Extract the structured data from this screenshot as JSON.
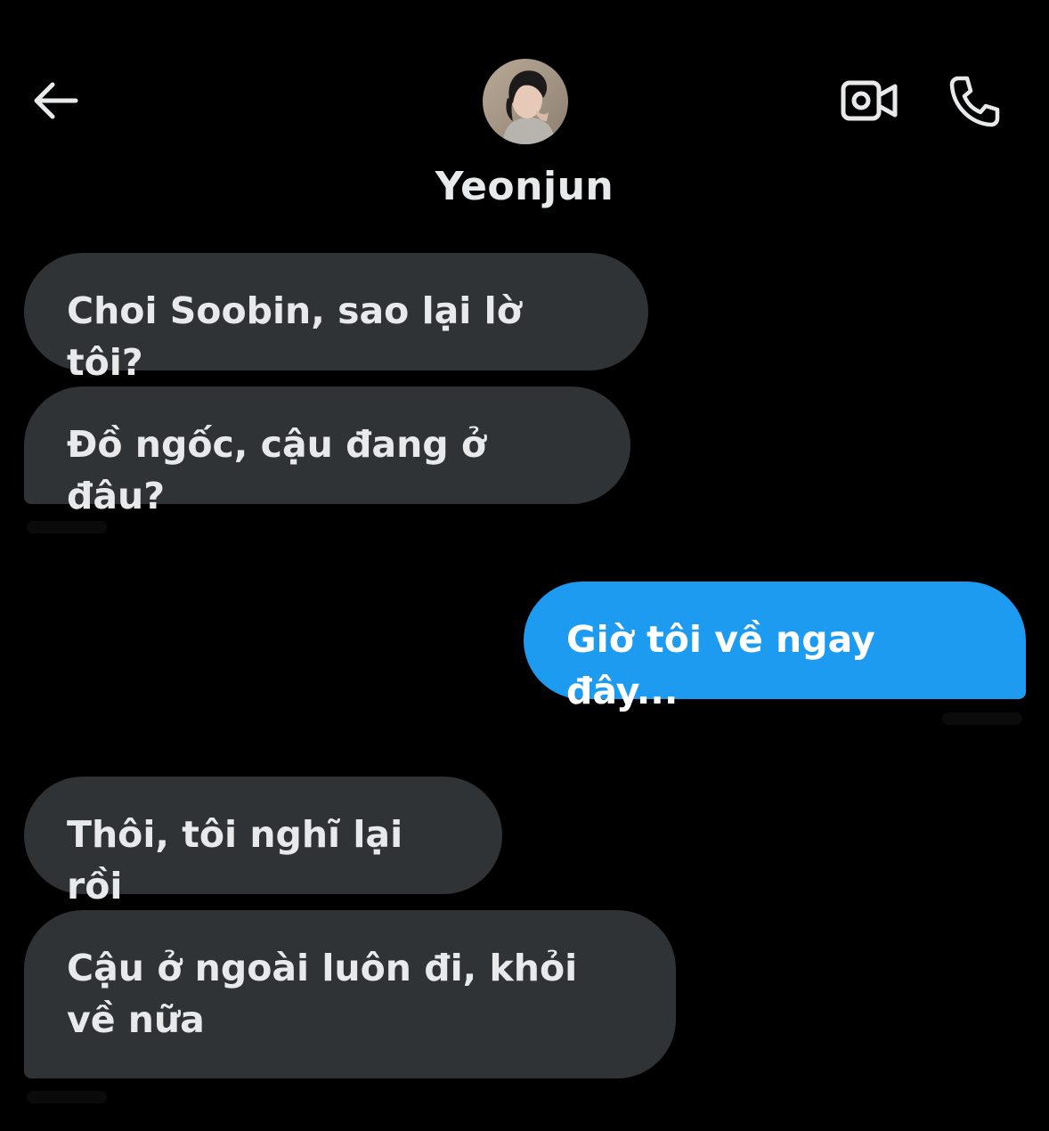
{
  "header": {
    "contact_name": "Yeonjun"
  },
  "icons": {
    "back": "arrow-left-icon",
    "video": "video-camera-icon",
    "call": "phone-icon"
  },
  "colors": {
    "background": "#000000",
    "received_bubble": "#2f3336",
    "sent_bubble": "#1d9bf0",
    "text_primary": "#e7e9ea"
  },
  "messages": [
    {
      "direction": "received",
      "text": "Choi Soobin, sao lại lờ tôi?"
    },
    {
      "direction": "received",
      "text": "Đồ ngốc, cậu đang ở đâu?"
    },
    {
      "direction": "sent",
      "text": "Giờ tôi về ngay đây..."
    },
    {
      "direction": "received",
      "text": "Thôi, tôi nghĩ lại rồi"
    },
    {
      "direction": "received",
      "text": "Cậu ở ngoài luôn đi, khỏi về nữa"
    }
  ]
}
